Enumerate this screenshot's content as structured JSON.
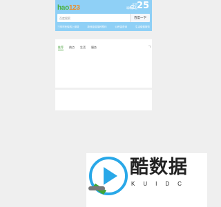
{
  "logo": {
    "part1": "hao",
    "part2": "123"
  },
  "weather": {
    "city": "北京",
    "desc": "晴转多云",
    "temp": "25",
    "unit": "°"
  },
  "search": {
    "placeholder": "百度搜索",
    "button_label": "百度一下"
  },
  "hot_links": [
    "三明市医保线上缴费",
    "新冠疫苗接种预约",
    "公积金查询",
    "生活缴费服务"
  ],
  "tabs": [
    {
      "label": "推荐",
      "active": true
    },
    {
      "label": "热点",
      "active": false
    },
    {
      "label": "生活",
      "active": false
    },
    {
      "label": "服务",
      "active": false
    }
  ],
  "watermark": {
    "title": "酷数据",
    "subtitle": "KUIDC"
  },
  "colors": {
    "header_bg": "#8fd0f6",
    "accent_green": "#4aa33e",
    "logo_orange": "#f08a1c",
    "page_bg": "#efefef"
  }
}
